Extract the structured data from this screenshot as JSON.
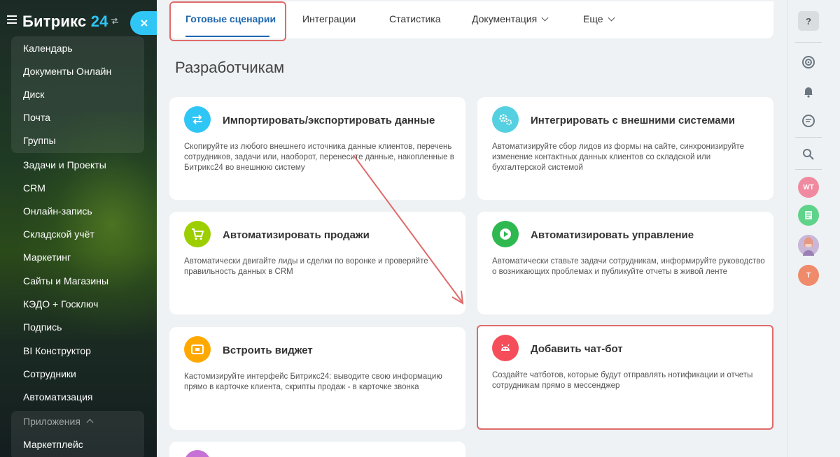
{
  "sidebar": {
    "logo_text": "Битрикс",
    "logo_num": "24",
    "items": [
      {
        "label": "Календарь"
      },
      {
        "label": "Документы Онлайн"
      },
      {
        "label": "Диск"
      },
      {
        "label": "Почта"
      },
      {
        "label": "Группы"
      },
      {
        "label": "Задачи и Проекты"
      },
      {
        "label": "CRM"
      },
      {
        "label": "Онлайн-запись"
      },
      {
        "label": "Складской учёт"
      },
      {
        "label": "Маркетинг"
      },
      {
        "label": "Сайты и Магазины"
      },
      {
        "label": "КЭДО + Госключ"
      },
      {
        "label": "Подпись"
      },
      {
        "label": "BI Конструктор"
      },
      {
        "label": "Сотрудники"
      },
      {
        "label": "Автоматизация"
      },
      {
        "label": "Приложения"
      },
      {
        "label": "Маркетплейс"
      }
    ],
    "accent": "#2fc6f6"
  },
  "tabs": [
    {
      "label": "Готовые сценарии"
    },
    {
      "label": "Интеграции"
    },
    {
      "label": "Статистика"
    },
    {
      "label": "Документация"
    },
    {
      "label": "Еще"
    }
  ],
  "page_title": "Разработчикам",
  "cards": [
    {
      "title": "Импортировать/экспортировать данные",
      "desc": "Скопируйте из любого внешнего источника данные клиентов, перечень сотрудников, задачи или, наоборот, перенесите данные, накопленные в Битрикс24 во внешнюю систему",
      "icon": "swap-arrows-icon",
      "color": "#2fc6f6"
    },
    {
      "title": "Интегрировать с внешними системами",
      "desc": "Автоматизируйте сбор лидов из формы на сайте, синхронизируйте изменение контактных данных клиентов со складской или бухгалтерской системой",
      "icon": "gears-icon",
      "color": "#55d0e0"
    },
    {
      "title": "Автоматизировать продажи",
      "desc": "Автоматически двигайте лиды и сделки по воронке и проверяйте правильность данных в CRM",
      "icon": "cart-icon",
      "color": "#9dcf00"
    },
    {
      "title": "Автоматизировать управление",
      "desc": "Автоматически ставьте задачи сотрудникам, информируйте руководство о возникающих проблемах и публикуйте отчеты в живой ленте",
      "icon": "play-icon",
      "color": "#2fb84f"
    },
    {
      "title": "Встроить виджет",
      "desc": "Кастомизируйте интерфейс Битрикс24: выводите свою информацию прямо в карточке клиента, скрипты продаж - в карточке звонка",
      "icon": "widget-icon",
      "color": "#ffa900"
    },
    {
      "title": "Добавить чат-бот",
      "desc": "Создайте чатботов, которые будут отправлять нотификации и отчеты сотрудникам прямо в мессенджер",
      "icon": "robot-icon",
      "color": "#f54e5a"
    }
  ],
  "right_panel": {
    "help_label": "?",
    "avatars": [
      {
        "initials": "WT",
        "color": "#f08aa0"
      },
      {
        "initials": "",
        "color": "#5fd38a"
      },
      {
        "initials": "",
        "color": "#c9b7d8"
      },
      {
        "initials": "T",
        "color": "#ef8b6a"
      }
    ]
  },
  "highlight_color": "#e06a6a"
}
